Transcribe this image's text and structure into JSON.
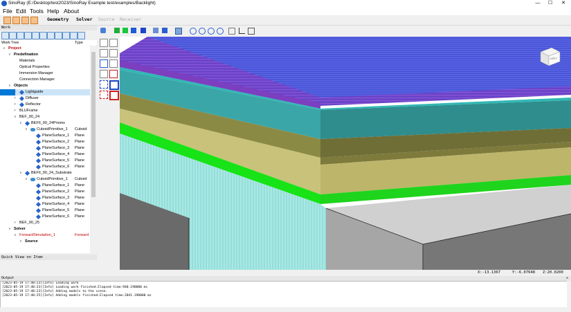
{
  "window": {
    "title": "SinoRay  (E:/Desktop/test2023/SinoRay Example test/examples/Backlight)",
    "controls": {
      "minimize": "—",
      "maximize": "☐",
      "close": "✕"
    }
  },
  "menu": {
    "items": [
      "File",
      "Edit",
      "Tools",
      "Help",
      "About"
    ]
  },
  "main_tabs": {
    "geometry": "Geometry",
    "solver": "Solver",
    "source": "Source",
    "receiver": "Receiver"
  },
  "work_panel": {
    "header": "Work",
    "columns": {
      "name": "Work Tree",
      "type": "Type"
    },
    "quick_view": "Quick View on Item"
  },
  "tree": [
    {
      "label": "Project",
      "type": "",
      "style": "red bold",
      "indent": 0,
      "arrow": "∨",
      "icon": ""
    },
    {
      "label": "Predefination",
      "type": "",
      "style": "bold",
      "indent": 1,
      "arrow": "∨",
      "icon": ""
    },
    {
      "label": "Materials",
      "type": "",
      "style": "",
      "indent": 2,
      "arrow": "",
      "icon": ""
    },
    {
      "label": "Optical Properties",
      "type": "",
      "style": "",
      "indent": 2,
      "arrow": "",
      "icon": ""
    },
    {
      "label": "Immersion Manager",
      "type": "",
      "style": "",
      "indent": 2,
      "arrow": "",
      "icon": ""
    },
    {
      "label": "Connection Manager",
      "type": "",
      "style": "",
      "indent": 2,
      "arrow": "",
      "icon": ""
    },
    {
      "label": "Objects",
      "type": "",
      "style": "bold",
      "indent": 1,
      "arrow": "∨",
      "icon": ""
    },
    {
      "label": "Lightguide",
      "type": "",
      "style": "selected",
      "indent": 2,
      "arrow": ">",
      "icon": "diamond"
    },
    {
      "label": "Diffuser",
      "type": "",
      "style": "",
      "indent": 2,
      "arrow": ">",
      "icon": "diamond"
    },
    {
      "label": "Reflector",
      "type": "",
      "style": "",
      "indent": 2,
      "arrow": ">",
      "icon": "diamond"
    },
    {
      "label": "BLUFrame",
      "type": "",
      "style": "",
      "indent": 2,
      "arrow": ">",
      "icon": ""
    },
    {
      "label": "BEF_90_24",
      "type": "",
      "style": "",
      "indent": 2,
      "arrow": "∨",
      "icon": ""
    },
    {
      "label": "BEFII_90_24Prisms",
      "type": "",
      "style": "",
      "indent": 3,
      "arrow": "∨",
      "icon": "diamond"
    },
    {
      "label": "CuboidPrimitive_1",
      "type": "Cuboid",
      "style": "",
      "indent": 4,
      "arrow": "∨",
      "icon": "shape"
    },
    {
      "label": "PlaneSurface_1",
      "type": "Plane",
      "style": "",
      "indent": 5,
      "arrow": "",
      "icon": "diamond"
    },
    {
      "label": "PlaneSurface_2",
      "type": "Plane",
      "style": "",
      "indent": 5,
      "arrow": "",
      "icon": "diamond"
    },
    {
      "label": "PlaneSurface_3",
      "type": "Plane",
      "style": "",
      "indent": 5,
      "arrow": "",
      "icon": "diamond"
    },
    {
      "label": "PlaneSurface_4",
      "type": "Plane",
      "style": "",
      "indent": 5,
      "arrow": "",
      "icon": "diamond"
    },
    {
      "label": "PlaneSurface_5",
      "type": "Plane",
      "style": "",
      "indent": 5,
      "arrow": "",
      "icon": "diamond"
    },
    {
      "label": "PlaneSurface_6",
      "type": "Plane",
      "style": "",
      "indent": 5,
      "arrow": "",
      "icon": "diamond"
    },
    {
      "label": "BEFII_90_24_Substrate",
      "type": "",
      "style": "",
      "indent": 3,
      "arrow": "∨",
      "icon": "diamond"
    },
    {
      "label": "CuboidPrimitive_1",
      "type": "Cuboid",
      "style": "",
      "indent": 4,
      "arrow": "∨",
      "icon": "shape"
    },
    {
      "label": "PlaneSurface_1",
      "type": "Plane",
      "style": "",
      "indent": 5,
      "arrow": "",
      "icon": "diamond"
    },
    {
      "label": "PlaneSurface_2",
      "type": "Plane",
      "style": "",
      "indent": 5,
      "arrow": "",
      "icon": "diamond"
    },
    {
      "label": "PlaneSurface_3",
      "type": "Plane",
      "style": "",
      "indent": 5,
      "arrow": "",
      "icon": "diamond"
    },
    {
      "label": "PlaneSurface_4",
      "type": "Plane",
      "style": "",
      "indent": 5,
      "arrow": "",
      "icon": "diamond"
    },
    {
      "label": "PlaneSurface_5",
      "type": "Plane",
      "style": "",
      "indent": 5,
      "arrow": "",
      "icon": "diamond"
    },
    {
      "label": "PlaneSurface_6",
      "type": "Plane",
      "style": "",
      "indent": 5,
      "arrow": "",
      "icon": "diamond"
    },
    {
      "label": "BEF_90_25",
      "type": "",
      "style": "",
      "indent": 2,
      "arrow": ">",
      "icon": ""
    },
    {
      "label": "Solver",
      "type": "",
      "style": "bold",
      "indent": 1,
      "arrow": "∨",
      "icon": ""
    },
    {
      "label": "ForwardSimulation_1",
      "type": "Forward",
      "style": "red",
      "indent": 2,
      "arrow": "∨",
      "icon": ""
    },
    {
      "label": "Source",
      "type": "",
      "style": "bold",
      "indent": 3,
      "arrow": "∨",
      "icon": ""
    }
  ],
  "viewport": {
    "cube_label": "LEFT",
    "coords": {
      "x": "X:-13.1367",
      "y": "Y:-6.07648",
      "z": "Z:20.0200"
    }
  },
  "output": {
    "header": "Output",
    "lines": [
      "[2023-05-19 17:40:23][Info] Loading work",
      "[2023-05-19 17:40:23][Info] Loading work finished.Elapsed time:940.190000 ms",
      "[2023-05-19 17:40:23][Info] Adding models to the scene.",
      "[2023-05-19 17:40:25][Info] Adding models finished.Elapsed time:2041.190000 ms"
    ]
  },
  "colors": {
    "selection": "#0078d7",
    "blue_layer": "#4a55d8",
    "purple_layer": "#7b3fc0",
    "teal_layer": "#3aa6a8",
    "olive_layer": "#8b8a45",
    "khaki_layer": "#c8c27a",
    "green_layer": "#17e316",
    "prism_layer": "#a8e9e6",
    "frame": "#6e6e6e"
  }
}
